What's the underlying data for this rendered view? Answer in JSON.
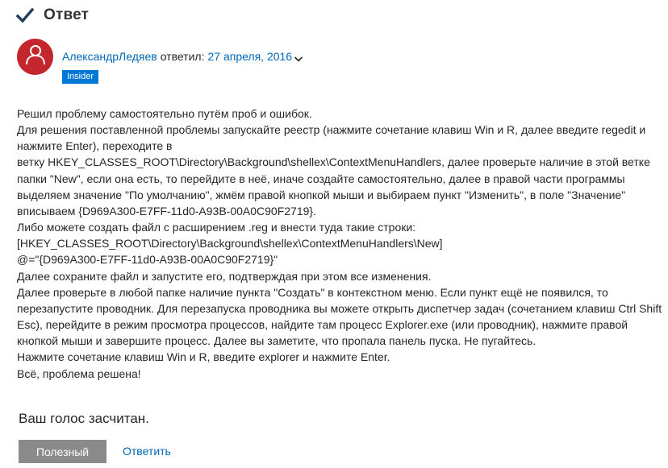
{
  "header": {
    "title": "Ответ"
  },
  "author": {
    "name": "АлександрЛедяев",
    "action": "ответил:",
    "date": "27 апреля, 2016",
    "badge": "Insider"
  },
  "body": {
    "lines": [
      "Решил проблему самостоятельно путём проб и ошибок.",
      "Для решения поставленной проблемы запускайте реестр (нажмите сочетание клавиш Win и R, далее введите regedit и нажмите Enter), переходите в",
      "ветку HKEY_CLASSES_ROOT\\Directory\\Background\\shellex\\ContextMenuHandlers, далее проверьте наличие в этой ветке папки \"New\", если она есть, то перейдите в неё, иначе создайте самостоятельно, далее в правой части программы выделяем значение \"По умолчанию\", жмём правой кнопкой мыши и выбираем пункт \"Изменить\", в поле \"Значение\" вписываем {D969A300-E7FF-11d0-A93B-00A0C90F2719}.",
      "Либо можете создать файл с расширением .reg и внести туда такие строки:",
      "[HKEY_CLASSES_ROOT\\Directory\\Background\\shellex\\ContextMenuHandlers\\New]",
      "@=\"{D969A300-E7FF-11d0-A93B-00A0C90F2719}\"",
      "Далее сохраните файл и запустите его, подтверждая при этом все изменения.",
      "Далее проверьте в любой папке наличие пункта \"Создать\" в контекстном меню. Если пункт ещё не появился, то перезапустите проводник. Для перезапуска проводника вы можете открыть диспетчер задач (сочетанием клавиш Ctrl Shift Esc), перейдите в режим просмотра процессов, найдите там процесс Explorer.exe (или проводник), нажмите правой кнопкой мыши и завершите процесс. Далее вы заметите, что пропала панель пуска. Не пугайтесь.",
      "Нажмите сочетание клавиш Win и R, введите explorer и нажмите Enter.",
      "Всё, проблема решена!"
    ]
  },
  "footer": {
    "vote_message": "Ваш голос засчитан.",
    "helpful_label": "Полезный",
    "reply_label": "Ответить"
  },
  "icons": {
    "check": "check-icon",
    "avatar": "person-icon",
    "chevron": "chevron-down-icon"
  },
  "colors": {
    "accent": "#0067b8",
    "badge": "#0078d4",
    "avatar": "#c4262e",
    "check": "#1f3d5c",
    "helpful_button": "#8a8a8a"
  }
}
